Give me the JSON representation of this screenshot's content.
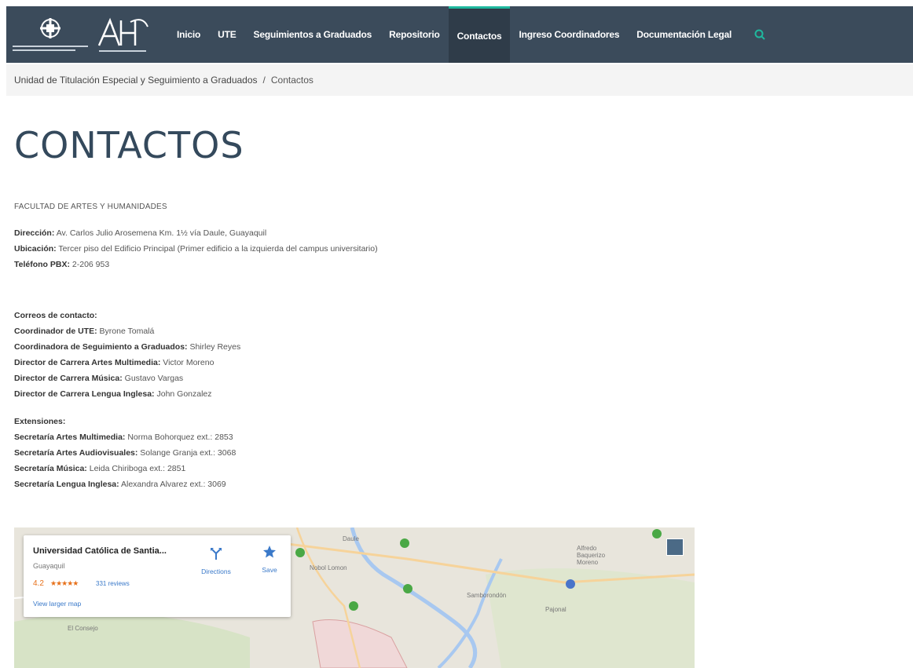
{
  "nav": {
    "items": [
      {
        "label": "Inicio",
        "active": false
      },
      {
        "label": "UTE",
        "active": false
      },
      {
        "label": "Seguimientos a Graduados",
        "active": false
      },
      {
        "label": "Repositorio",
        "active": false
      },
      {
        "label": "Contactos",
        "active": true
      },
      {
        "label": "Ingreso Coordinadores",
        "active": false
      },
      {
        "label": "Documentación Legal",
        "active": false
      }
    ],
    "search_icon": "search-icon",
    "accent_color": "#1fb89e",
    "bg_color": "#3b4b5b"
  },
  "breadcrumb": {
    "parent": "Unidad de Titulación Especial y Seguimiento a Graduados",
    "separator": "/",
    "current": "Contactos"
  },
  "page": {
    "title": "CONTACTOS",
    "faculty": "FACULTAD DE ARTES Y HUMANIDADES",
    "address_label": "Dirección:",
    "address_value": " Av. Carlos Julio Arosemena Km. 1½ vía Daule, Guayaquil",
    "location_label": "Ubicación:",
    "location_value": " Tercer piso del Edificio Principal (Primer edificio a la izquierda del campus universitario)",
    "phone_label": "Teléfono PBX:",
    "phone_value": " 2-206 953",
    "emails_heading": "Correos de contacto:",
    "contacts": [
      {
        "label": "Coordinador de UTE:",
        "value": "  Byrone Tomalá"
      },
      {
        "label": "Coordinadora de Seguimiento a Graduados:",
        "value": "  Shirley Reyes"
      },
      {
        "label": "Director de Carrera Artes Multimedia:",
        "value": " Victor Moreno"
      },
      {
        "label": "Director de Carrera Música:",
        "value": " Gustavo Vargas"
      },
      {
        "label": "Director de Carrera Lengua Inglesa:",
        "value": " John Gonzalez"
      }
    ],
    "extensions_heading": "Extensiones:",
    "extensions": [
      {
        "label": "Secretaría Artes Multimedia:",
        "value": " Norma Bohorquez ext.: 2853"
      },
      {
        "label": "Secretaría Artes Audiovisuales:",
        "value": " Solange Granja ext.: 3068"
      },
      {
        "label": "Secretaría Música:",
        "value": " Leida Chiriboga ext.: 2851"
      },
      {
        "label": "Secretaría Lengua Inglesa:",
        "value": " Alexandra Alvarez ext.: 3069"
      }
    ]
  },
  "map": {
    "place_name": "Universidad Católica de Santia...",
    "city": "Guayaquil",
    "rating": "4.2",
    "stars": "★★★★★",
    "reviews": "331 reviews",
    "directions_label": "Directions",
    "save_label": "Save",
    "view_larger": "View larger map",
    "labels": [
      "Daule",
      "Nobol Lomon",
      "Alfredo Baquerizo Moreno",
      "Samborondón",
      "Pajonal",
      "El Consejo"
    ]
  }
}
